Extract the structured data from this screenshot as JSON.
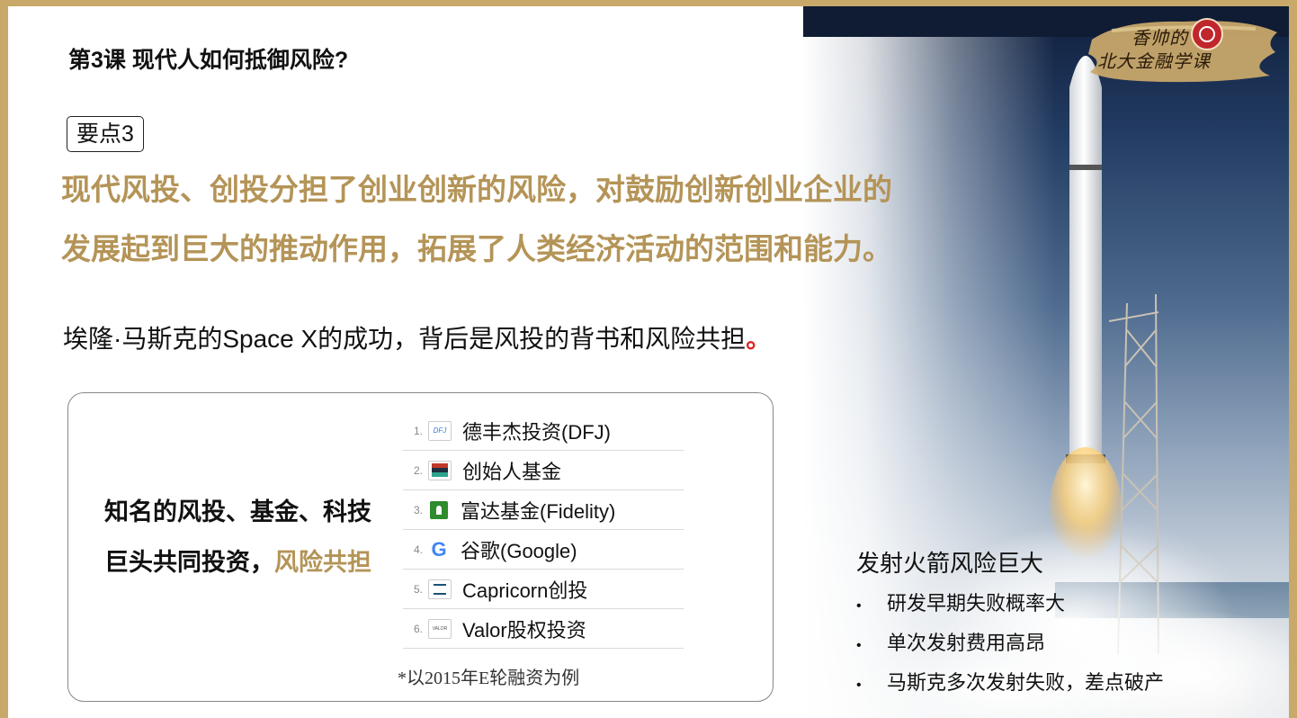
{
  "lesson_title": "第3课  现代人如何抵御风险?",
  "point_tag": "要点3",
  "headline": {
    "line1": "现代风投、创投分担了创业创新的风险，对鼓励创新创业企业的",
    "line2": "发展起到巨大的推动作用，拓展了人类经济活动的范围和能力。"
  },
  "subline": {
    "text": "埃隆·马斯克的Space X的成功，背后是风投的背书和风险共担",
    "end_mark": "。"
  },
  "card": {
    "left_text_black": "知名的风投、基金、科技巨头共同投资，",
    "left_text_gold": "风险共担",
    "investors": [
      {
        "num": "1.",
        "name": "德丰杰投资(DFJ)",
        "logo": "dfj-logo",
        "logo_text": "DFJ"
      },
      {
        "num": "2.",
        "name": "创始人基金",
        "logo": "founders-fund-logo",
        "logo_text": ""
      },
      {
        "num": "3.",
        "name": "富达基金(Fidelity)",
        "logo": "fidelity-logo",
        "logo_text": ""
      },
      {
        "num": "4.",
        "name": "谷歌(Google)",
        "logo": "google-logo",
        "logo_text": "G"
      },
      {
        "num": "5.",
        "name": "Capricorn创投",
        "logo": "capricorn-logo",
        "logo_text": ""
      },
      {
        "num": "6.",
        "name": "Valor股权投资",
        "logo": "valor-logo",
        "logo_text": "VALOR"
      }
    ],
    "note": "*以2015年E轮融资为例"
  },
  "risk": {
    "title": "发射火箭风险巨大",
    "bullet": "•",
    "items": [
      "研发早期失败概率大",
      "单次发射费用高昂",
      "马斯克多次发射失败，差点破产"
    ]
  },
  "logo": {
    "line1": "香帅的",
    "line2": "北大金融学课"
  },
  "colors": {
    "gold": "#b49457",
    "border_gold": "#c8a96a",
    "red": "#e02020"
  }
}
